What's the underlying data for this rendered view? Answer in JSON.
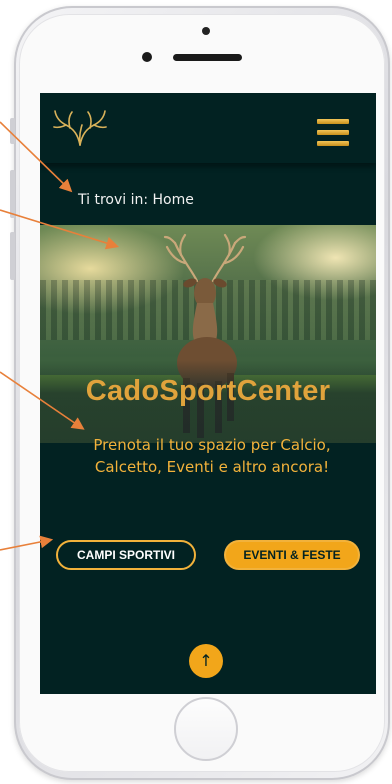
{
  "breadcrumb": {
    "prefix": "Ti trovi in:",
    "current": "Home"
  },
  "hero": {
    "title": "CadoSportCenter",
    "tagline": "Prenota il tuo spazio per Calcio, Calcetto, Eventi e altro ancora!"
  },
  "buttons": {
    "primary": "CAMPI SPORTIVI",
    "secondary": "EVENTI & FESTE"
  },
  "scroll_top": {
    "glyph": "↑"
  },
  "icons": {
    "logo": "antler-logo-icon",
    "menu": "hamburger-menu-icon",
    "scroll": "arrow-up-icon"
  },
  "colors": {
    "background": "#022222",
    "accent": "#f2a61a",
    "title": "#e0a33c",
    "annotation": "#e8803a"
  }
}
